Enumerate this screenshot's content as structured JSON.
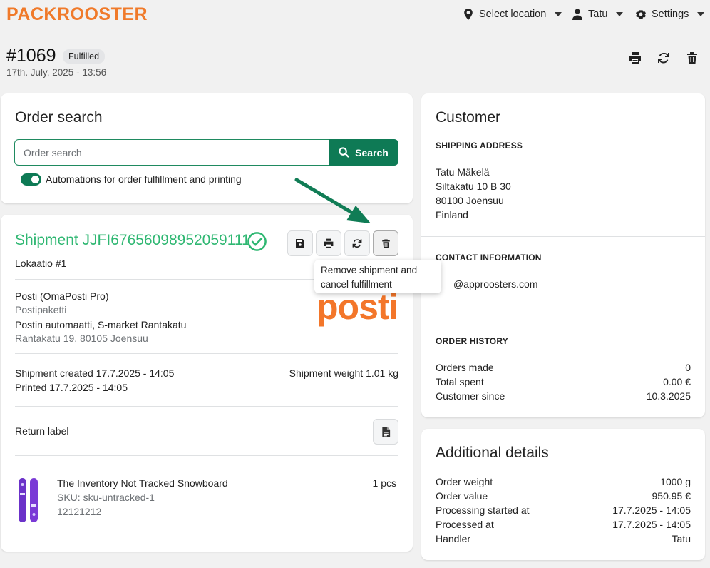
{
  "app": {
    "logo_text": "PACKROOSTER"
  },
  "nav": {
    "location_label": "Select location",
    "user_label": "Tatu",
    "settings_label": "Settings"
  },
  "order": {
    "number": "#1069",
    "status": "Fulfilled",
    "date": "17th. July, 2025 - 13:56"
  },
  "order_search": {
    "title": "Order search",
    "placeholder": "Order search",
    "button_label": "Search",
    "toggle_label": "Automations for order fulfillment and printing",
    "toggle_on": true
  },
  "shipment": {
    "title": "Shipment JJFI67656098952059111",
    "location": "Lokaatio #1",
    "tooltip": "Remove shipment and cancel fulfillment",
    "carrier": "Posti (OmaPosti Pro)",
    "service": "Postipaketti",
    "pickup_point": "Postin automaatti, S-market Rantakatu",
    "pickup_address": "Rantakatu 19, 80105 Joensuu",
    "carrier_logo_text": "posti",
    "created": "Shipment created 17.7.2025 - 14:05",
    "printed": "Printed 17.7.2025 - 14:05",
    "weight": "Shipment weight 1.01 kg",
    "return_label": "Return label",
    "item": {
      "name": "The Inventory Not Tracked Snowboard",
      "sku": "SKU: sku-untracked-1",
      "barcode": "12121212",
      "quantity": "1 pcs"
    }
  },
  "customer": {
    "title": "Customer",
    "shipping_heading": "SHIPPING ADDRESS",
    "address_lines": [
      "Tatu Mäkelä",
      "Siltakatu 10 B 30",
      "80100 Joensuu",
      "Finland"
    ],
    "contact_heading": "CONTACT INFORMATION",
    "email_visible": "@approosters.com",
    "history_heading": "ORDER HISTORY",
    "history": [
      {
        "label": "Orders made",
        "value": "0"
      },
      {
        "label": "Total spent",
        "value": "0.00 €"
      },
      {
        "label": "Customer since",
        "value": "10.3.2025"
      }
    ]
  },
  "additional": {
    "title": "Additional details",
    "rows": [
      {
        "label": "Order weight",
        "value": "1000 g"
      },
      {
        "label": "Order value",
        "value": "950.95 €"
      },
      {
        "label": "Processing started at",
        "value": "17.7.2025 - 14:05"
      },
      {
        "label": "Processed at",
        "value": "17.7.2025 - 14:05"
      },
      {
        "label": "Handler",
        "value": "Tatu"
      }
    ]
  },
  "colors": {
    "brand_orange": "#f07a2a",
    "primary_green": "#0e7a55",
    "shipment_green": "#2fb772",
    "annotation_arrow": "#107c55"
  },
  "icons": {
    "location": "map-pin-icon",
    "user": "user-icon",
    "settings": "gear-icon",
    "print": "printer-icon",
    "refresh": "refresh-icon",
    "delete": "trash-icon",
    "save": "save-icon",
    "document": "document-icon",
    "search": "search-icon",
    "check": "check-circle-icon"
  }
}
